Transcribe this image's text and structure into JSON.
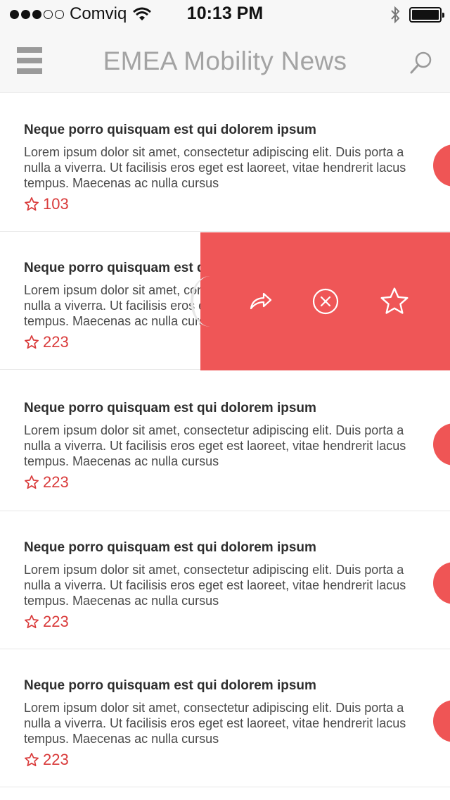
{
  "status_bar": {
    "carrier": "Comviq",
    "time": "10:13 PM",
    "signal_icon": "signal-dots",
    "wifi_icon": "wifi-icon",
    "bluetooth_icon": "bluetooth-icon",
    "battery_level": 1.0
  },
  "nav": {
    "title": "EMEA Mobility News",
    "menu_icon": "menu-icon",
    "search_icon": "search-icon"
  },
  "articles": [
    {
      "title": "Neque porro quisquam est qui dolorem ipsum",
      "body": "Lorem ipsum dolor sit amet, consectetur adipiscing elit. Duis porta a nulla a viverra. Ut facilisis eros eget est laoreet, vitae hendrerit lacus tempus. Maecenas ac nulla cursus",
      "stars": "103"
    },
    {
      "title": "Neque porro quisquam est qui dolorem ipsum",
      "body": "Lorem ipsum dolor sit amet, consectetur adipiscing elit. Duis porta a nulla a viverra. Ut facilisis eros eget est laoreet, vitae hendrerit lacus tempus. Maecenas ac nulla cursus",
      "stars": "223"
    },
    {
      "title": "Neque porro quisquam est qui dolorem ipsum",
      "body": "Lorem ipsum dolor sit amet, consectetur adipiscing elit. Duis porta a nulla a viverra. Ut facilisis eros eget est laoreet, vitae hendrerit lacus tempus. Maecenas ac nulla cursus",
      "stars": "223"
    },
    {
      "title": "Neque porro quisquam est qui dolorem ipsum",
      "body": "Lorem ipsum dolor sit amet, consectetur adipiscing elit. Duis porta a nulla a viverra. Ut facilisis eros eget est laoreet, vitae hendrerit lacus tempus. Maecenas ac nulla cursus",
      "stars": "223"
    },
    {
      "title": "Neque porro quisquam est qui dolorem ipsum",
      "body": "Lorem ipsum dolor sit amet, consectetur adipiscing elit. Duis porta a nulla a viverra. Ut facilisis eros eget est laoreet, vitae hendrerit lacus tempus. Maecenas ac nulla cursus",
      "stars": "223"
    }
  ],
  "swipe_actions": {
    "share_icon": "share-icon",
    "dismiss_icon": "close-circle-icon",
    "favorite_icon": "star-icon"
  },
  "colors": {
    "accent": "#ef5657",
    "star": "#d93a3a",
    "nav_title": "#a3a3a3"
  }
}
